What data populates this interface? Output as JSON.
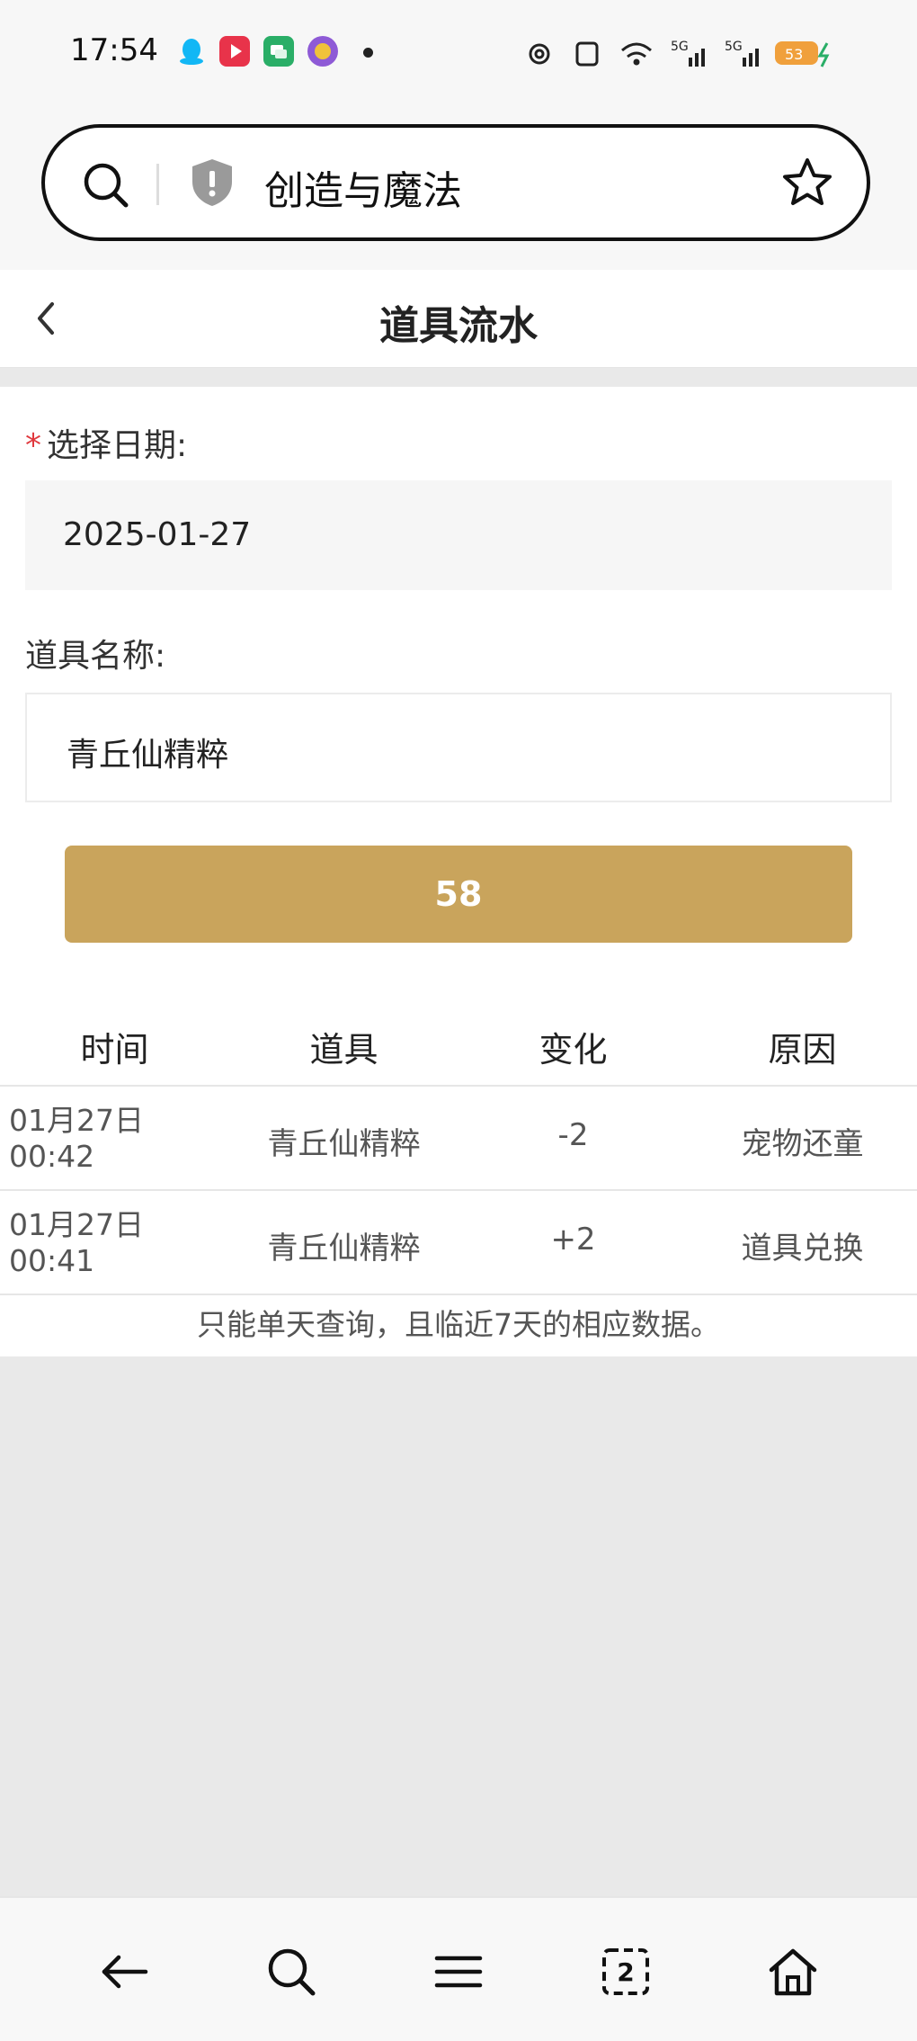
{
  "status_bar": {
    "time": "17:54",
    "notification_icons": [
      "qq-icon",
      "video-app-icon",
      "chat-app-icon",
      "app-badge-icon"
    ],
    "status_icons": [
      "hotspot-icon",
      "vibrate-icon",
      "wifi-icon",
      "signal-5g-icon",
      "signal-5g-icon",
      "battery-icon"
    ],
    "battery_level": "53"
  },
  "address_bar": {
    "text": "创造与魔法"
  },
  "header": {
    "title": "道具流水"
  },
  "form": {
    "date_required_mark": "*",
    "date_label": "选择日期:",
    "date_value": "2025-01-27",
    "item_label": "道具名称:",
    "item_value": "青丘仙精粹",
    "button_label": "58"
  },
  "table": {
    "headers": [
      "时间",
      "道具",
      "变化",
      "原因"
    ],
    "rows": [
      {
        "date": "01月27日",
        "time": "00:42",
        "item": "青丘仙精粹",
        "change": "-2",
        "reason": "宠物还童"
      },
      {
        "date": "01月27日",
        "time": "00:41",
        "item": "青丘仙精粹",
        "change": "+2",
        "reason": "道具兑换"
      }
    ],
    "note": "只能单天查询，且临近7天的相应数据。"
  },
  "bottom_nav": {
    "tab_count": "2",
    "items": [
      "back-arrow-icon",
      "search-icon",
      "menu-icon",
      "tabs-icon",
      "home-icon"
    ]
  },
  "colors": {
    "accent": "#c9a45c",
    "required": "#e0393e"
  }
}
